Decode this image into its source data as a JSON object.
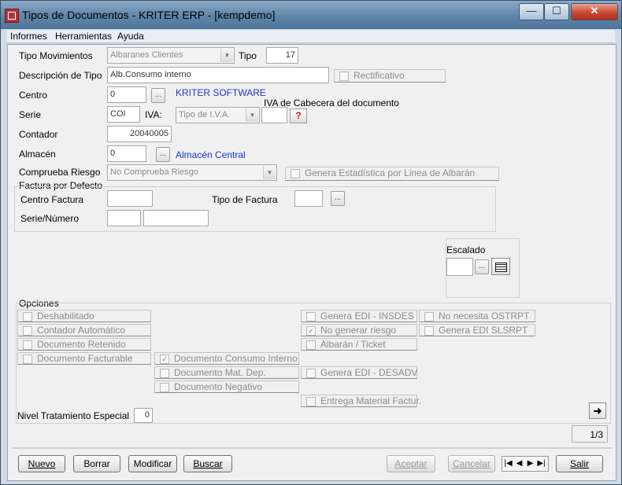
{
  "window": {
    "title": "Tipos de Documentos - KRITER ERP - [kempdemo]",
    "controls": {
      "minimize": "—",
      "maximize": "☐",
      "close": "✕"
    }
  },
  "menu": [
    "Informes",
    "Herramientas",
    "Ayuda"
  ],
  "form": {
    "tipo_movimientos_label": "Tipo Movimientos",
    "tipo_movimientos_value": "Albaranes Clientes",
    "tipo_label": "Tipo",
    "tipo_value": "17",
    "descripcion_label": "Descripción de Tipo",
    "descripcion_value": "Alb.Consumo interno",
    "rectificativo_label": "Rectificativo",
    "centro_label": "Centro",
    "centro_value": "0",
    "centro_name": "KRITER SOFTWARE",
    "iva_cabecera_label": "IVA de Cabecera del documento",
    "serie_label": "Serie",
    "serie_value": "COI",
    "iva_label": "IVA:",
    "iva_value": "Tipo de I.V.A.",
    "contador_label": "Contador",
    "contador_value": "20040005",
    "almacen_label": "Almacén",
    "almacen_value": "0",
    "almacen_name": "Almacén Central",
    "comprueba_riesgo_label": "Comprueba Riesgo",
    "comprueba_riesgo_value": "No Comprueba Riesgo",
    "genera_estadistica_label": "Genera Estadística por Linea de Albarán",
    "factura_defecto_label": "Factura por Defecto",
    "centro_factura_label": "Centro Factura",
    "tipo_factura_label": "Tipo de Factura",
    "serie_numero_label": "Serie/Número",
    "escalado_label": "Escalado"
  },
  "options": {
    "title": "Opciones",
    "col1": [
      {
        "label": "Deshabilitado",
        "checked": false
      },
      {
        "label": "Contador Automático",
        "checked": false
      },
      {
        "label": "Documento Retenido",
        "checked": false
      },
      {
        "label": "Documento Facturable",
        "checked": false
      }
    ],
    "col2": [
      {
        "label": "Documento Consumo Interno",
        "checked": true
      },
      {
        "label": "Documento Mat. Dep.",
        "checked": false
      },
      {
        "label": "Documento Negativo",
        "checked": false
      }
    ],
    "col3": [
      {
        "label": "Genera EDI - INSDES",
        "checked": false
      },
      {
        "label": "No generar riesgo",
        "checked": true
      },
      {
        "label": "Albarán / Ticket",
        "checked": false
      },
      {
        "label": "Genera EDI - DESADV",
        "checked": false
      },
      {
        "label": "Entrega Material Factur.",
        "checked": false
      }
    ],
    "col4": [
      {
        "label": "No necesita OSTRPT",
        "checked": false
      },
      {
        "label": "Genera EDI SLSRPT",
        "checked": false
      }
    ],
    "nivel_label": "Nivel Tratamiento Especial",
    "nivel_value": "0"
  },
  "page_indicator": "1/3",
  "buttons": {
    "nuevo": "Nuevo",
    "borrar": "Borrar",
    "modificar": "Modificar",
    "buscar": "Buscar",
    "aceptar": "Aceptar",
    "cancelar": "Cancelar",
    "salir": "Salir"
  },
  "nav_glyphs": {
    "first": "|◀",
    "prev": "◀",
    "next": "▶",
    "last": "▶|"
  },
  "colors": {
    "link_blue": "#1f36d0",
    "close_red": "#c64832"
  }
}
